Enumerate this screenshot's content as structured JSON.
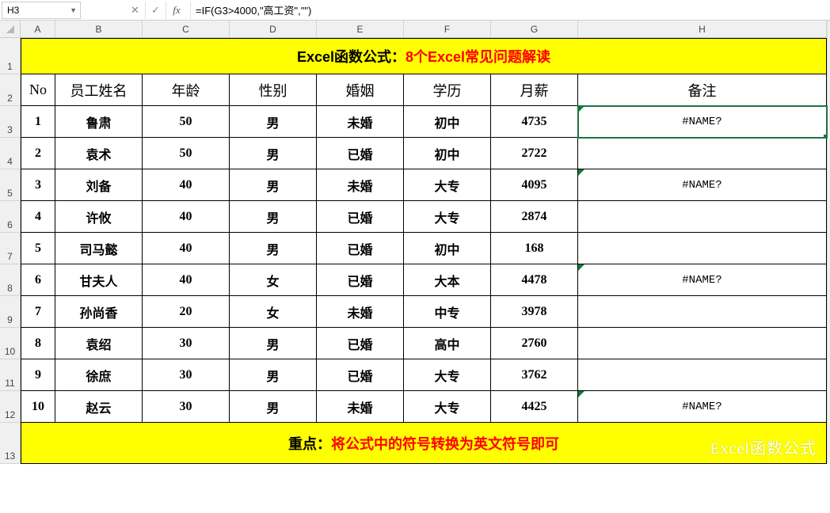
{
  "formula_bar": {
    "cell_ref": "H3",
    "cancel": "✕",
    "confirm": "✓",
    "fx": "fx",
    "formula": "=IF(G3>4000,\"高工资\",\"\")"
  },
  "columns": {
    "labels": [
      "A",
      "B",
      "C",
      "D",
      "E",
      "F",
      "G",
      "H"
    ],
    "widths": [
      44,
      110,
      110,
      110,
      110,
      110,
      110,
      314
    ]
  },
  "row_heights": {
    "title": 46,
    "header": 40,
    "data": 40,
    "footer": 52
  },
  "rows": [
    "1",
    "2",
    "3",
    "4",
    "5",
    "6",
    "7",
    "8",
    "9",
    "10",
    "11",
    "12",
    "13"
  ],
  "title": {
    "black": "Excel函数公式：",
    "red": "8个Excel常见问题解读"
  },
  "headers": [
    "No",
    "员工姓名",
    "年龄",
    "性别",
    "婚姻",
    "学历",
    "月薪",
    "备注"
  ],
  "data": [
    {
      "no": "1",
      "name": "鲁肃",
      "age": "50",
      "sex": "男",
      "mar": "未婚",
      "edu": "初中",
      "sal": "4735",
      "rem": "#NAME?",
      "err": true
    },
    {
      "no": "2",
      "name": "袁术",
      "age": "50",
      "sex": "男",
      "mar": "已婚",
      "edu": "初中",
      "sal": "2722",
      "rem": "",
      "err": false
    },
    {
      "no": "3",
      "name": "刘备",
      "age": "40",
      "sex": "男",
      "mar": "未婚",
      "edu": "大专",
      "sal": "4095",
      "rem": "#NAME?",
      "err": true
    },
    {
      "no": "4",
      "name": "许攸",
      "age": "40",
      "sex": "男",
      "mar": "已婚",
      "edu": "大专",
      "sal": "2874",
      "rem": "",
      "err": false
    },
    {
      "no": "5",
      "name": "司马懿",
      "age": "40",
      "sex": "男",
      "mar": "已婚",
      "edu": "初中",
      "sal": "168",
      "rem": "",
      "err": false
    },
    {
      "no": "6",
      "name": "甘夫人",
      "age": "40",
      "sex": "女",
      "mar": "已婚",
      "edu": "大本",
      "sal": "4478",
      "rem": "#NAME?",
      "err": true
    },
    {
      "no": "7",
      "name": "孙尚香",
      "age": "20",
      "sex": "女",
      "mar": "未婚",
      "edu": "中专",
      "sal": "3978",
      "rem": "",
      "err": false
    },
    {
      "no": "8",
      "name": "袁绍",
      "age": "30",
      "sex": "男",
      "mar": "已婚",
      "edu": "高中",
      "sal": "2760",
      "rem": "",
      "err": false
    },
    {
      "no": "9",
      "name": "徐庶",
      "age": "30",
      "sex": "男",
      "mar": "已婚",
      "edu": "大专",
      "sal": "3762",
      "rem": "",
      "err": false
    },
    {
      "no": "10",
      "name": "赵云",
      "age": "30",
      "sex": "男",
      "mar": "未婚",
      "edu": "大专",
      "sal": "4425",
      "rem": "#NAME?",
      "err": true
    }
  ],
  "footer": {
    "black": "重点：",
    "red": "将公式中的符号转换为英文符号即可"
  },
  "watermark": "Excel函数公式",
  "selected": {
    "row_index": 0,
    "col_key": "rem"
  }
}
